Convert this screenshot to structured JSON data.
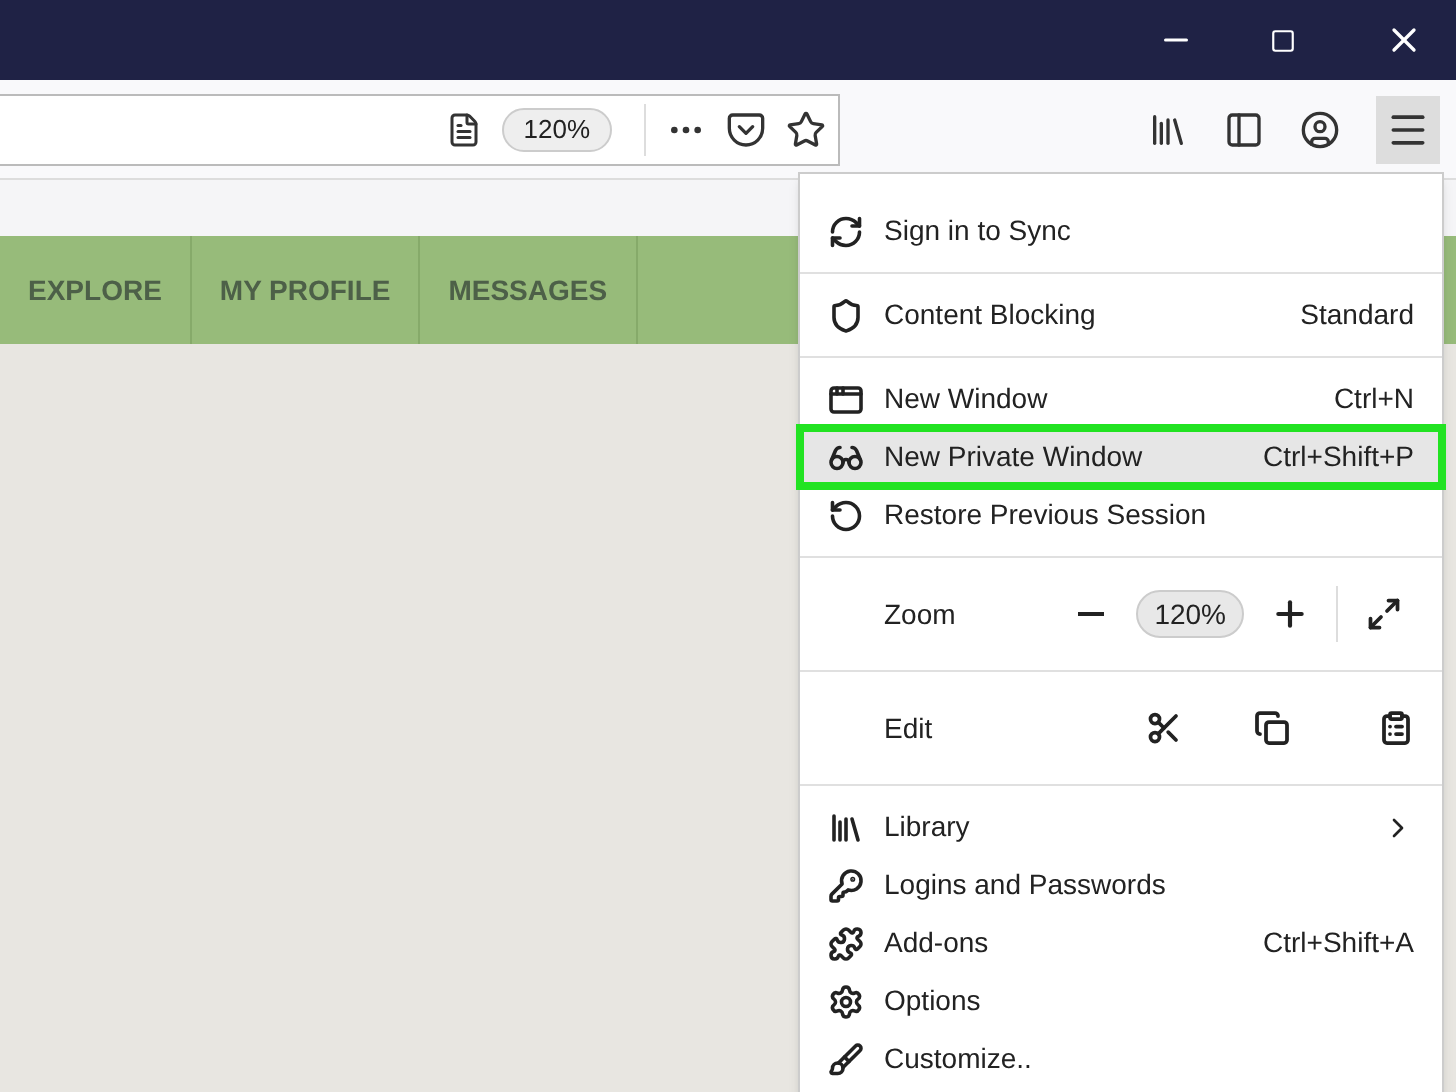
{
  "toolbar": {
    "zoom_badge": "120%"
  },
  "nav": {
    "items": [
      {
        "label": "EXPLORE"
      },
      {
        "label": "MY PROFILE"
      },
      {
        "label": "MESSAGES"
      }
    ]
  },
  "menu": {
    "sections": [
      [
        {
          "kind": "item",
          "label": "Sign in to Sync",
          "selected": false
        }
      ],
      [
        {
          "kind": "item",
          "label": "Content Blocking",
          "shortcut": "Standard",
          "selected": false
        }
      ],
      [
        {
          "kind": "item",
          "label": "New Window",
          "shortcut": "Ctrl+N",
          "selected": false
        },
        {
          "kind": "item",
          "label": "New Private Window",
          "shortcut": "Ctrl+Shift+P",
          "selected": true
        },
        {
          "kind": "item",
          "label": "Restore Previous Session",
          "selected": false
        }
      ],
      [
        {
          "kind": "zoom",
          "label": "Zoom",
          "value": "120%"
        }
      ],
      [
        {
          "kind": "edit",
          "label": "Edit"
        }
      ],
      [
        {
          "kind": "item",
          "label": "Library",
          "submenu": true,
          "selected": false
        },
        {
          "kind": "item",
          "label": "Logins and Passwords",
          "selected": false
        },
        {
          "kind": "item",
          "label": "Add-ons",
          "shortcut": "Ctrl+Shift+A",
          "selected": false
        },
        {
          "kind": "item",
          "label": "Options",
          "selected": false
        },
        {
          "kind": "item",
          "label": "Customize..",
          "selected": false
        }
      ]
    ]
  }
}
